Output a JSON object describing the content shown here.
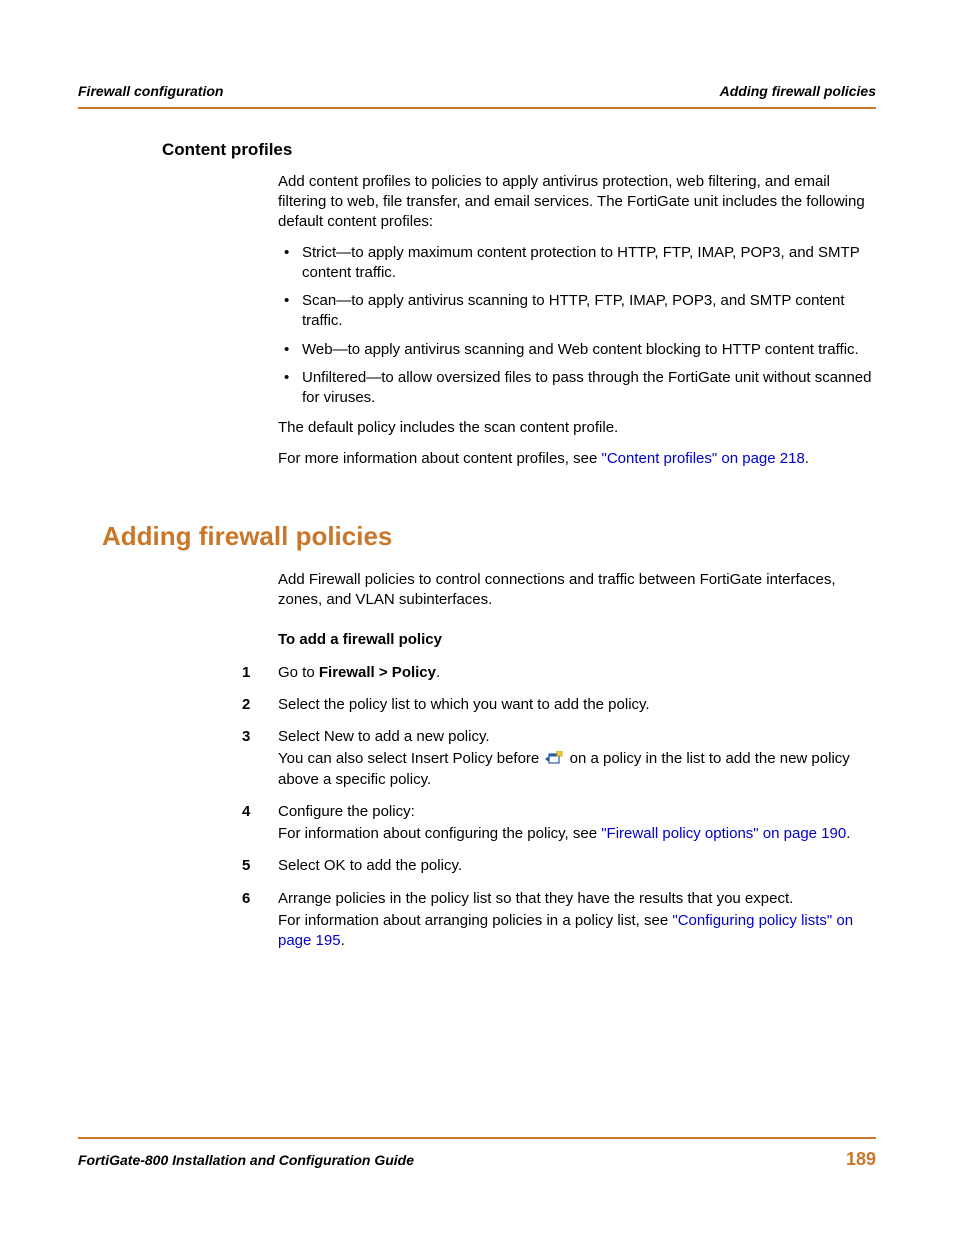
{
  "header": {
    "left": "Firewall configuration",
    "right": "Adding firewall policies"
  },
  "content_profiles": {
    "heading": "Content profiles",
    "intro": "Add content profiles to policies to apply antivirus protection, web filtering, and email filtering to web, file transfer, and email services. The FortiGate unit includes the following default content profiles:",
    "bullets": [
      "Strict—to apply maximum content protection to HTTP, FTP, IMAP, POP3, and SMTP content traffic.",
      "Scan—to apply antivirus scanning to HTTP, FTP, IMAP, POP3, and SMTP content traffic.",
      "Web—to apply antivirus scanning and Web content blocking to HTTP content traffic.",
      "Unfiltered—to allow oversized files to pass through the FortiGate unit without scanned for viruses."
    ],
    "after1": "The default policy includes the scan content profile.",
    "after2_pre": "For more information about content profiles, see ",
    "after2_link": "\"Content profiles\" on page 218",
    "after2_post": "."
  },
  "adding": {
    "heading": "Adding firewall policies",
    "intro": "Add Firewall policies to control connections and traffic between FortiGate interfaces, zones, and VLAN subinterfaces.",
    "proc_title": "To add a firewall policy",
    "steps": {
      "s1_num": "1",
      "s1_a": "Go to ",
      "s1_b": "Firewall > Policy",
      "s1_c": ".",
      "s2_num": "2",
      "s2": "Select the policy list to which you want to add the policy.",
      "s3_num": "3",
      "s3_a": "Select New to add a new policy.",
      "s3_b_pre": "You can also select Insert Policy before ",
      "s3_b_post": " on a policy in the list to add the new policy above a specific policy.",
      "s4_num": "4",
      "s4_a": "Configure the policy:",
      "s4_b_pre": "For information about configuring the policy, see ",
      "s4_b_link": "\"Firewall policy options\" on page 190",
      "s4_b_post": ".",
      "s5_num": "5",
      "s5": "Select OK to add the policy.",
      "s6_num": "6",
      "s6_a": "Arrange policies in the policy list so that they have the results that you expect.",
      "s6_b_pre": "For information about arranging policies in a policy list, see ",
      "s6_b_link": "\"Configuring policy lists\" on page 195",
      "s6_b_post": "."
    }
  },
  "footer": {
    "left": "FortiGate-800 Installation and Configuration Guide",
    "page": "189"
  }
}
